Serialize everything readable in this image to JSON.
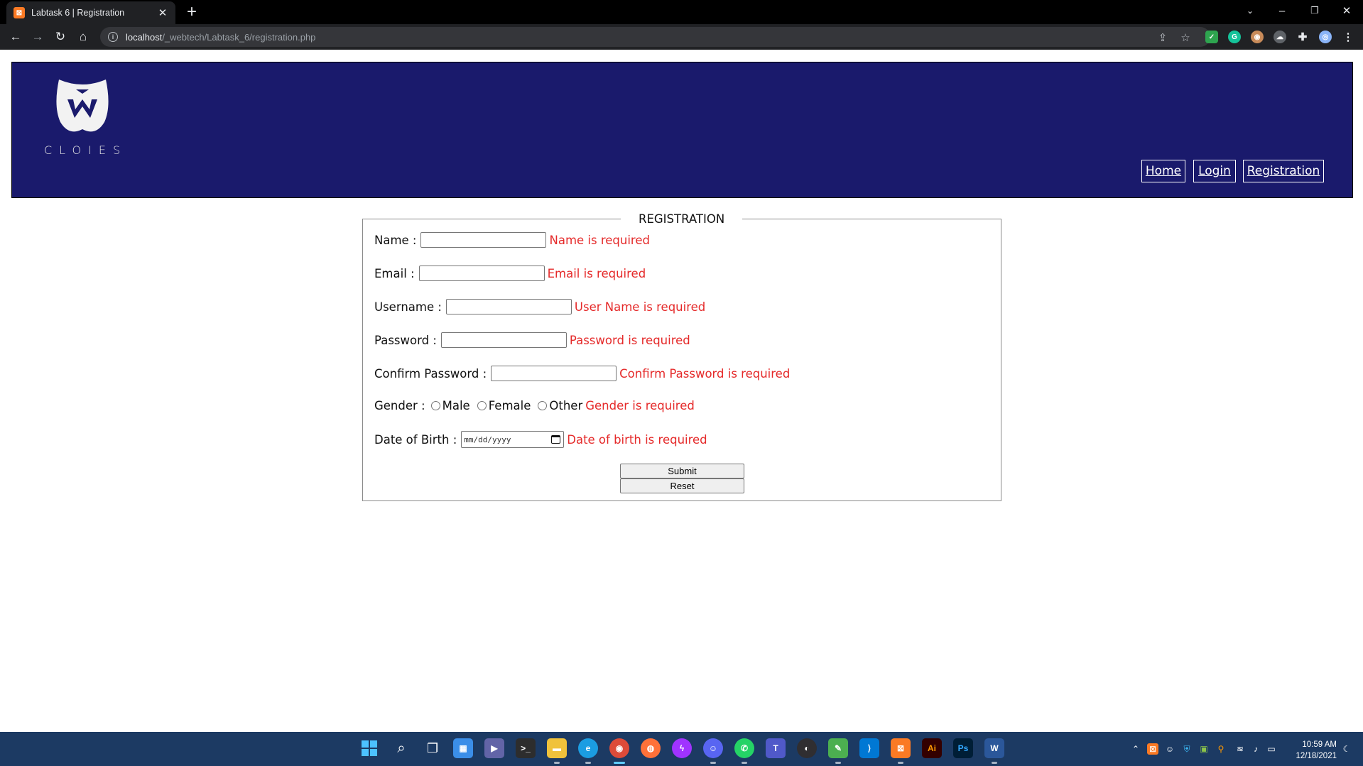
{
  "browser": {
    "tab_title": "Labtask 6 | Registration",
    "tab_favicon": "xampp-icon",
    "url_host": "localhost",
    "url_path": "/_webtech/Labtask_6/registration.php"
  },
  "site": {
    "logo_text": "CLOIES",
    "nav": [
      {
        "label": "Home"
      },
      {
        "label": "Login"
      },
      {
        "label": "Registration"
      }
    ]
  },
  "form": {
    "legend": "REGISTRATION",
    "fields": {
      "name": {
        "label": "Name :",
        "error": "Name is required"
      },
      "email": {
        "label": "Email :",
        "error": "Email is required"
      },
      "username": {
        "label": "Username :",
        "error": "User Name is required"
      },
      "password": {
        "label": "Password :",
        "error": "Password is required"
      },
      "confirm_password": {
        "label": "Confirm Password :",
        "error": "Confirm Password is required"
      },
      "gender": {
        "label": "Gender :",
        "options": [
          "Male",
          "Female",
          "Other"
        ],
        "error": "Gender is required"
      },
      "dob": {
        "label": "Date of Birth :",
        "placeholder": "mm/dd/yyyy",
        "error": "Date of birth is required"
      }
    },
    "submit_label": "Submit",
    "reset_label": "Reset"
  },
  "taskbar": {
    "time": "10:59 AM",
    "date": "12/18/2021"
  },
  "colors": {
    "header_bg": "#1a1a6c",
    "error": "#e52a2a",
    "taskbar_bg": "#1c3a63"
  }
}
